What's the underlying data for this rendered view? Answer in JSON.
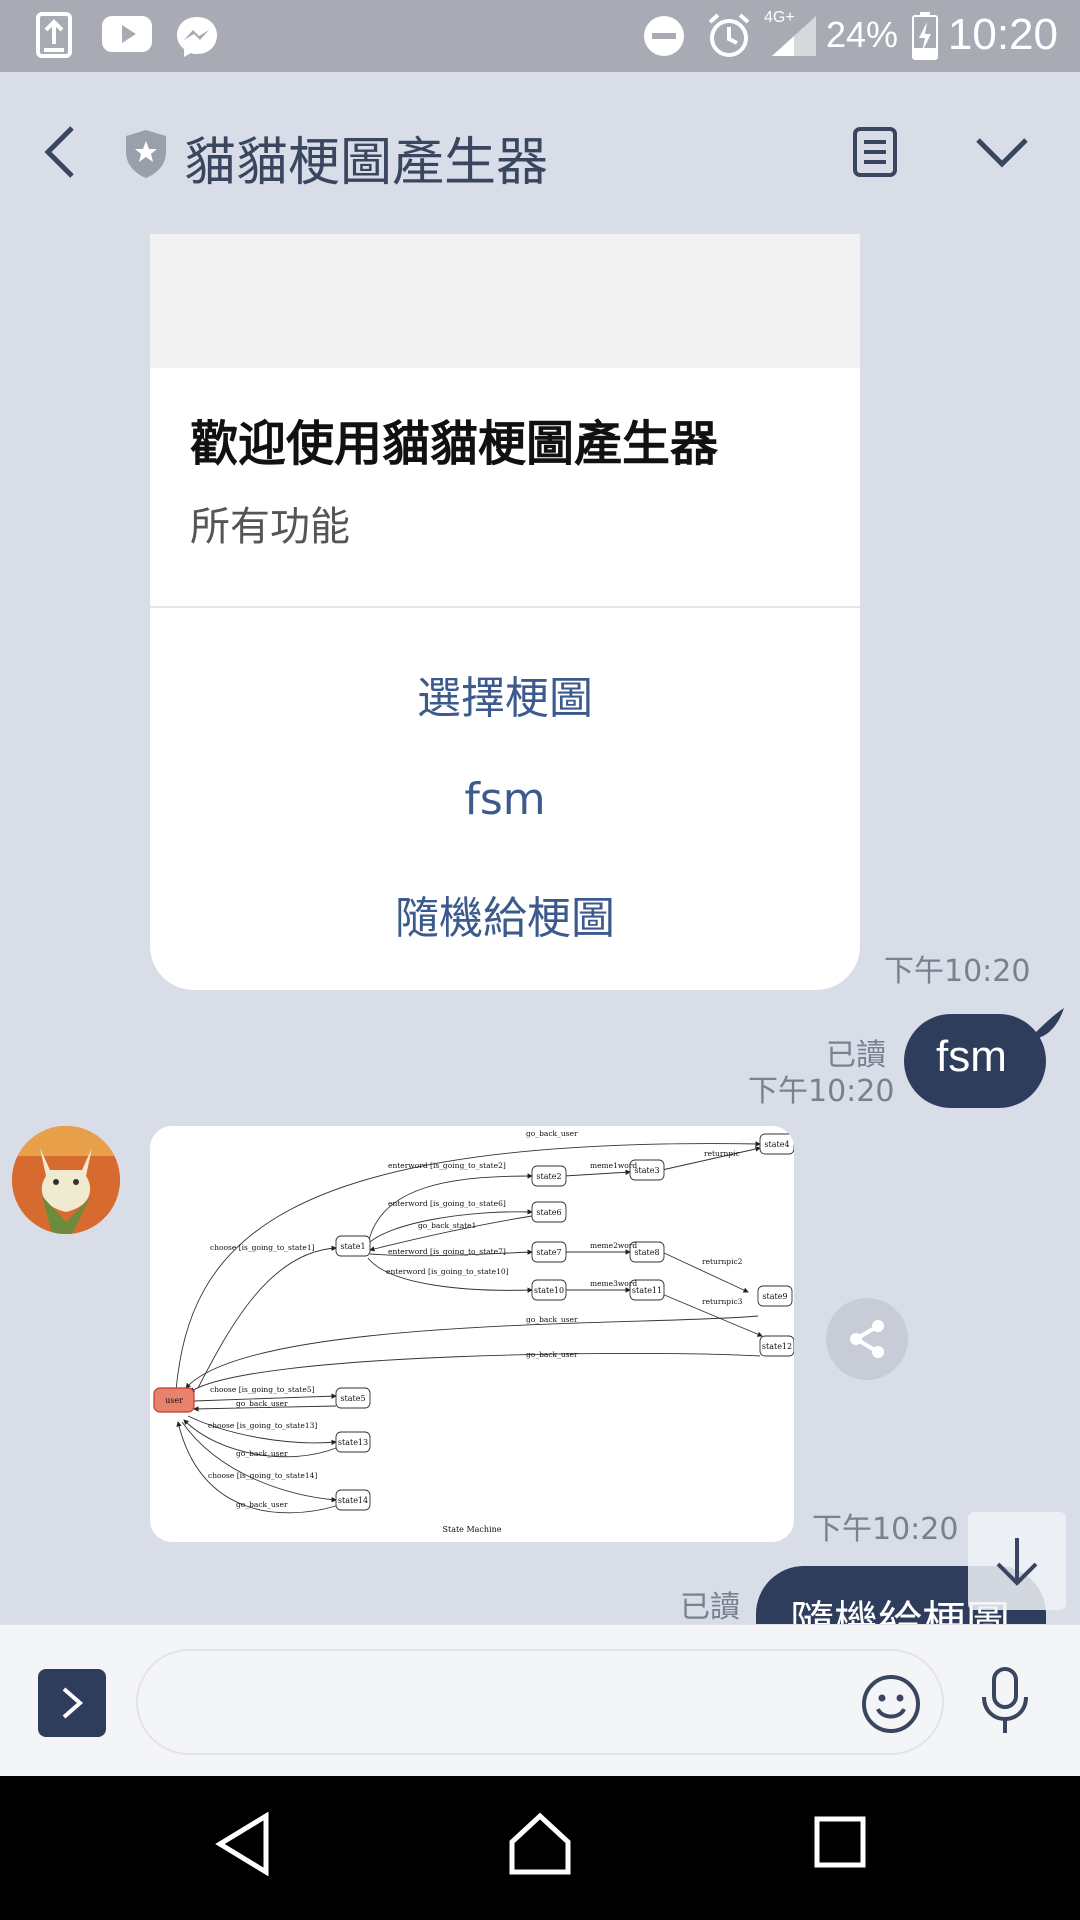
{
  "status_bar": {
    "network": "4G+",
    "battery_percent": "24%",
    "time": "10:20"
  },
  "header": {
    "title": "貓貓梗圖產生器"
  },
  "card": {
    "title": "歡迎使用貓貓梗圖產生器",
    "subtitle": "所有功能",
    "actions": [
      {
        "label": "選擇梗圖"
      },
      {
        "label": "fsm"
      },
      {
        "label": "隨機給梗圖"
      }
    ],
    "timestamp": "下午10:20"
  },
  "messages": [
    {
      "direction": "out",
      "read_label": "已讀",
      "timestamp": "下午10:20",
      "text": "fsm"
    },
    {
      "direction": "in",
      "type": "image",
      "timestamp": "下午10:20"
    },
    {
      "direction": "out",
      "read_label": "已讀",
      "text": "隨機給梗圖"
    }
  ],
  "fsm_diagram": {
    "caption": "State Machine",
    "nodes": [
      "user",
      "state1",
      "state2",
      "state3",
      "state4",
      "state6",
      "state7",
      "state8",
      "state9",
      "state10",
      "state11",
      "state12",
      "state5",
      "state13",
      "state14"
    ],
    "edge_labels": [
      "go_back_user",
      "enterword [is_going_to_state2]",
      "meme1word",
      "returnpic",
      "enterword [is_going_to_state6]",
      "go_back_state1",
      "choose [is_going_to_state1]",
      "enterword [is_going_to_state7]",
      "meme2word",
      "returnpic2",
      "enterword [is_going_to_state10]",
      "meme3word",
      "returnpic3",
      "go_back_user",
      "go_back_user",
      "choose [is_going_to_state5]",
      "go_back_user",
      "choose [is_going_to_state13]",
      "go_back_user",
      "choose [is_going_to_state14]",
      "go_back_user"
    ]
  },
  "input": {
    "placeholder": ""
  },
  "colors": {
    "background": "#d8dde8",
    "outgoing_bubble": "#2f3d5c",
    "action_link": "#3d5a8c",
    "user_node": "#e8826c"
  }
}
